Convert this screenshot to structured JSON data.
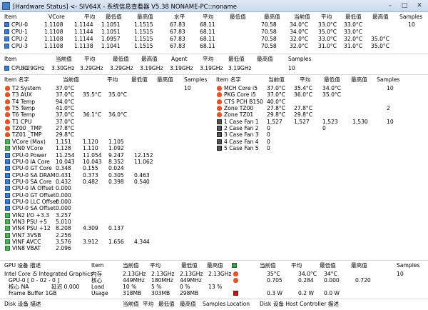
{
  "window": {
    "title": "[Hardware Status] <- SIV64X - 系统信息查看器 V5.38 NONAME-PC::noname",
    "controls": [
      "–",
      "□",
      "✕"
    ]
  },
  "cpu_table": {
    "headers": [
      "Item",
      "VCore",
      "平均",
      "最低值",
      "最高值",
      "水平",
      "平均",
      "最低值",
      "最高值",
      "当前值",
      "平均",
      "最低值",
      "最高值",
      "Samples"
    ],
    "rows": [
      [
        "CPU-0",
        "1.1108",
        "1.1144",
        "1.1051",
        "1.1515",
        "67.83",
        "68.11",
        "",
        "70.58",
        "34.0°C",
        "33.0°C",
        "33.0°C",
        "",
        "10"
      ],
      [
        "CPU-1",
        "1.1108",
        "1.1144",
        "1.1051",
        "1.1515",
        "67.83",
        "68.11",
        "",
        "70.58",
        "34.0°C",
        "35.0°C",
        "33.0°C",
        "",
        ""
      ],
      [
        "CPU-2",
        "1.1108",
        "1.1144",
        "1.0957",
        "1.1515",
        "67.83",
        "68.11",
        "",
        "70.58",
        "32.0°C",
        "33.0°C",
        "32.0°C",
        "35.0°C",
        ""
      ],
      [
        "CPU-3",
        "1.1108",
        "1.1138",
        "1.1041",
        "1.1515",
        "67.83",
        "68.11",
        "",
        "70.58",
        "32.0°C",
        "31.0°C",
        "31.0°C",
        "35.0°C",
        ""
      ]
    ]
  },
  "freq_table": {
    "headers": [
      "Item",
      "当前值",
      "平均",
      "最低值",
      "最高值",
      "Agent",
      "平均",
      "最低值",
      "最高值",
      "Samples"
    ],
    "row": [
      "CPU-0",
      "3.29GHz",
      "3.30GHz",
      "3.29GHz",
      "3.29GHz",
      "3.19GHz",
      "3.19GHz",
      "3.19GHz",
      "3.19GHz",
      "10"
    ]
  },
  "sensors_left": {
    "headers": [
      "Item 名字",
      "当前值",
      "平均",
      "最低值",
      "最高值",
      "Samples"
    ],
    "rows": [
      {
        "icon": "flame",
        "name": "T2 System",
        "vals": [
          "37.0°C",
          "",
          "",
          "",
          "10"
        ]
      },
      {
        "icon": "flame",
        "name": "T3 AUX",
        "vals": [
          "37.0°C",
          "35.5°C",
          "35.0°C",
          "",
          ""
        ]
      },
      {
        "icon": "flame",
        "name": "T4 Temp",
        "vals": [
          "94.0°C",
          "",
          "",
          "",
          ""
        ]
      },
      {
        "icon": "flame",
        "name": "T5 Temp",
        "vals": [
          "41.0°C",
          "",
          "",
          "",
          ""
        ]
      },
      {
        "icon": "flame",
        "name": "T6 Temp",
        "vals": [
          "37.0°C",
          "36.1°C",
          "36.0°C",
          "",
          ""
        ]
      },
      {
        "icon": "flame",
        "name": "T1 CPU",
        "vals": [
          "37.0°C",
          "",
          "",
          "",
          ""
        ]
      },
      {
        "icon": "flame",
        "name": "TZ00 _TMP",
        "vals": [
          "27.8°C",
          "",
          "",
          "",
          ""
        ]
      },
      {
        "icon": "flame",
        "name": "TZ01 _TMP",
        "vals": [
          "29.8°C",
          "",
          "",
          "",
          ""
        ]
      },
      {
        "icon": "volt",
        "name": "VCore (Max)",
        "vals": [
          "1.151",
          "1.120",
          "1.105",
          "",
          ""
        ]
      },
      {
        "icon": "volt",
        "name": "VIN0 VCore",
        "vals": [
          "1.128",
          "1.110",
          "1.092",
          "",
          ""
        ]
      },
      {
        "icon": "cpu",
        "name": "CPU-0 Power",
        "vals": [
          "11.254",
          "11.054",
          "9.247",
          "12.152",
          ""
        ]
      },
      {
        "icon": "cpu",
        "name": "CPU-0 IA Core",
        "vals": [
          "10.043",
          "10.043",
          "8.352",
          "11.062",
          ""
        ]
      },
      {
        "icon": "cpu",
        "name": "CPU-0 GT Core",
        "vals": [
          "0.348",
          "0.155",
          "0.024",
          "",
          ""
        ]
      },
      {
        "icon": "cpu",
        "name": "CPU-0 SA DRAM",
        "vals": [
          "0.431",
          "0.373",
          "0.305",
          "0.463",
          ""
        ]
      },
      {
        "icon": "cpu",
        "name": "CPU-0 SA Core",
        "vals": [
          "0.432",
          "0.482",
          "0.398",
          "0.540",
          ""
        ]
      },
      {
        "icon": "cpu",
        "name": "CPU-0 IA Offset",
        "vals": [
          "0.000",
          "",
          "",
          "",
          ""
        ]
      },
      {
        "icon": "cpu",
        "name": "CPU-0 GT Offset",
        "vals": [
          "0.000",
          "",
          "",
          "",
          ""
        ]
      },
      {
        "icon": "cpu",
        "name": "CPU-0 LLC Offset",
        "vals": [
          "0.000",
          "",
          "",
          "",
          ""
        ]
      },
      {
        "icon": "cpu",
        "name": "CPU-0 SA Offset",
        "vals": [
          "0.000",
          "",
          "",
          "",
          ""
        ]
      },
      {
        "icon": "volt",
        "name": "VIN2 I/O +3.3",
        "vals": [
          "3.257",
          "",
          "",
          "",
          ""
        ]
      },
      {
        "icon": "volt",
        "name": "VIN3 PSU +5",
        "vals": [
          "5.010",
          "",
          "",
          "",
          ""
        ]
      },
      {
        "icon": "volt",
        "name": "VIN4 PSU +12",
        "vals": [
          "8.208",
          "4.309",
          "0.137",
          "",
          ""
        ]
      },
      {
        "icon": "volt",
        "name": "VIN7 3VSB",
        "vals": [
          "2.256",
          "",
          "",
          "",
          ""
        ]
      },
      {
        "icon": "volt",
        "name": "VINF AVCC",
        "vals": [
          "3.576",
          "3.912",
          "1.656",
          "4.344",
          ""
        ]
      },
      {
        "icon": "volt",
        "name": "VIN8 VBAT",
        "vals": [
          "2.096",
          "",
          "",
          "",
          ""
        ]
      }
    ]
  },
  "sensors_right": {
    "headers": [
      "Item 名字",
      "当前值",
      "平均",
      "最低值",
      "最高值",
      "Samples"
    ],
    "rows": [
      {
        "icon": "flame",
        "name": "MCH Core i5",
        "vals": [
          "37.0°C",
          "35.4°C",
          "34.0°C",
          "",
          "10"
        ]
      },
      {
        "icon": "flame",
        "name": "PKG Core i5",
        "vals": [
          "37.0°C",
          "36.0°C",
          "35.0°C",
          "",
          ""
        ]
      },
      {
        "icon": "flame",
        "name": "CTS PCH B150",
        "vals": [
          "40.0°C",
          "",
          "",
          "",
          ""
        ]
      },
      {
        "icon": "flame",
        "name": "Zone TZ00",
        "vals": [
          "27.8°C",
          "27.8°C",
          "",
          "",
          "2"
        ]
      },
      {
        "icon": "flame",
        "name": "Zone TZ01",
        "vals": [
          "29.8°C",
          "29.8°C",
          "",
          "",
          ""
        ]
      },
      {
        "icon": "fan",
        "name": "1 Case Fan 1",
        "vals": [
          "1,527",
          "1,527",
          "1,523",
          "1,530",
          "10"
        ]
      },
      {
        "icon": "fan",
        "name": "2 Case Fan 2",
        "vals": [
          "0",
          "",
          "0",
          "",
          ""
        ]
      },
      {
        "icon": "fan",
        "name": "3 Case Fan 3",
        "vals": [
          "0",
          "",
          "",
          "",
          ""
        ]
      },
      {
        "icon": "fan",
        "name": "4 Case Fan 4",
        "vals": [
          "0",
          "",
          "",
          "",
          ""
        ]
      },
      {
        "icon": "fan",
        "name": "5 Case Fan 5",
        "vals": [
          "0",
          "",
          "",
          "",
          ""
        ]
      }
    ]
  },
  "gpu": {
    "headers": [
      "GPU 设备 描述",
      "Item",
      "当前值",
      "平均",
      "最低值",
      "最高值",
      "当前值",
      "平均",
      "最低值",
      "最高值",
      "Samples"
    ],
    "device_name": "Intel Core i5 Integrated Graphics",
    "gpu_label": "GPU-0 [ 0 - 02 - 0 ]",
    "core_label": "核心 NA",
    "core_extra": "延迟 0.000",
    "fb_label": "Frame Buffer 1GB",
    "rows": [
      {
        "item": "内存",
        "vals": [
          "2.13GHz",
          "2.13GHz",
          "2.13GHz",
          "2.13GHz"
        ],
        "right": [
          "35°C",
          "34.0°C",
          "34°C",
          "",
          "10"
        ],
        "right_icon": "flame"
      },
      {
        "item": "核心",
        "vals": [
          "449MHz",
          "180MHz",
          "449MHz",
          ""
        ],
        "right": [
          "0.705",
          "0.284",
          "0.000",
          "0.720",
          ""
        ],
        "right_icon": "flame"
      },
      {
        "item": "Load",
        "vals": [
          "10 %",
          "5 %",
          "0 %",
          "13 %"
        ],
        "right": [
          "",
          "",
          "",
          "",
          ""
        ],
        "right_icon": ""
      },
      {
        "item": "Usage",
        "vals": [
          "318MB",
          "303MB",
          "298MB",
          ""
        ],
        "right": [
          "0.3 W",
          "0.2 W",
          "0.0 W",
          "",
          ""
        ],
        "right_icon": "red"
      }
    ]
  },
  "footer": {
    "left_headers": [
      "Disk 设备 描述",
      "当前值",
      "平均",
      "最低值",
      "最高值",
      "Samples",
      "Location"
    ],
    "right_headers": [
      "Disk 设备 Host Controller 描述"
    ]
  }
}
